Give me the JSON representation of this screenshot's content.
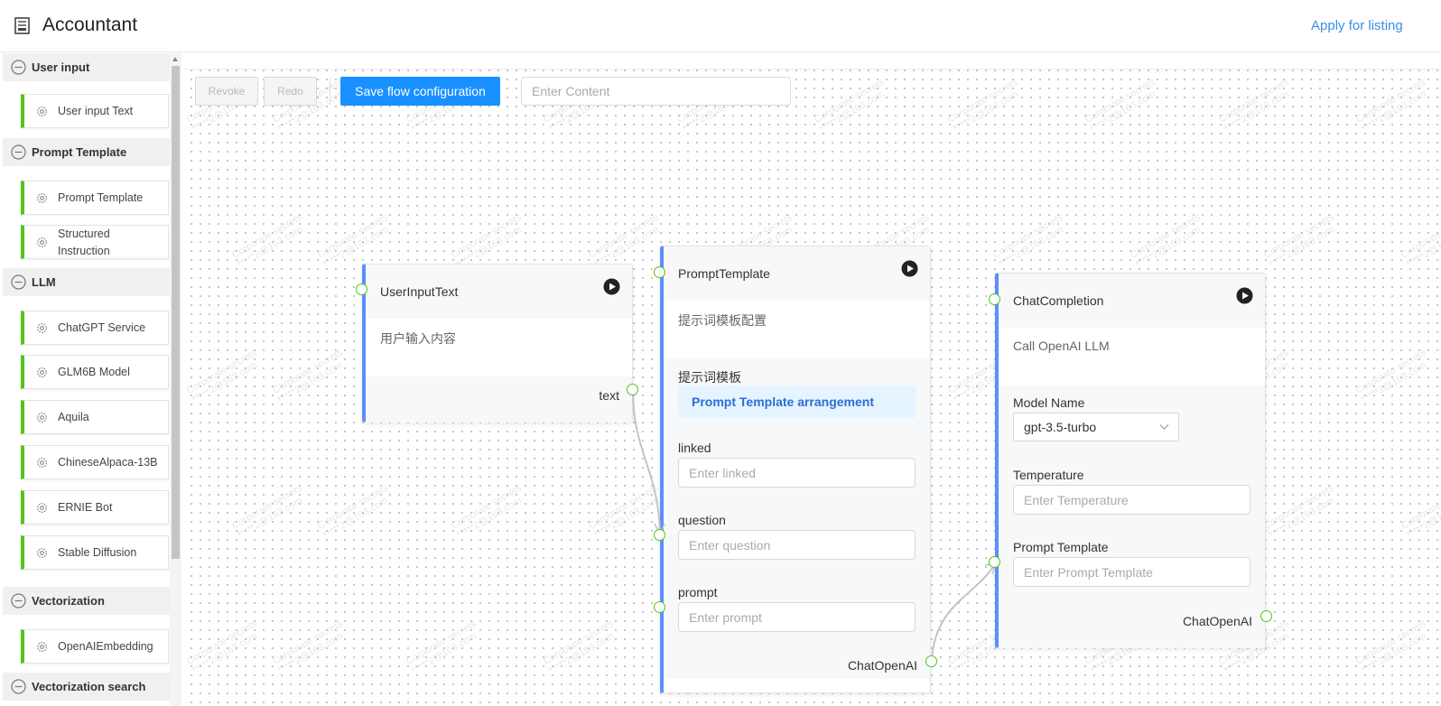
{
  "header": {
    "title": "Accountant",
    "apply_label": "Apply for listing"
  },
  "sidebar": {
    "categories": [
      {
        "label": "User input",
        "items": [
          {
            "label": "User input Text"
          }
        ]
      },
      {
        "label": "Prompt Template",
        "items": [
          {
            "label": "Prompt Template"
          },
          {
            "label": "Structured Instruction"
          }
        ]
      },
      {
        "label": "LLM",
        "items": [
          {
            "label": "ChatGPT Service"
          },
          {
            "label": "GLM6B Model"
          },
          {
            "label": "Aquila"
          },
          {
            "label": "ChineseAlpaca-13B"
          },
          {
            "label": "ERNIE Bot"
          },
          {
            "label": "Stable Diffusion"
          }
        ]
      },
      {
        "label": "Vectorization",
        "items": [
          {
            "label": "OpenAIEmbedding"
          }
        ]
      },
      {
        "label": "Vectorization search",
        "items": []
      }
    ]
  },
  "toolbar": {
    "revoke_label": "Revoke",
    "redo_label": "Redo",
    "save_label": "Save flow configuration",
    "search_placeholder": "Enter Content"
  },
  "watermark": {
    "line1": "Corporate secrets",
    "line2": "*****2@163.com"
  },
  "nodes": {
    "user_input": {
      "title": "UserInputText",
      "description": "用户输入内容",
      "output_label": "text"
    },
    "prompt": {
      "title": "PromptTemplate",
      "description": "提示词模板配置",
      "template_label": "提示词模板",
      "template_button": "Prompt Template arrangement",
      "fields": [
        {
          "label": "linked",
          "placeholder": "Enter linked"
        },
        {
          "label": "question",
          "placeholder": "Enter question"
        },
        {
          "label": "prompt",
          "placeholder": "Enter prompt"
        }
      ],
      "output_label": "ChatOpenAI"
    },
    "chat": {
      "title": "ChatCompletion",
      "description": "Call OpenAI LLM",
      "model_label": "Model Name",
      "model_value": "gpt-3.5-turbo",
      "temperature_label": "Temperature",
      "temperature_placeholder": "Enter Temperature",
      "prompt_label": "Prompt Template",
      "prompt_placeholder": "Enter Prompt Template",
      "output_label": "ChatOpenAI"
    }
  },
  "colors": {
    "accent": "#1890ff",
    "node_border": "#5b8ff9",
    "item_border": "#52c41a",
    "port": "#52c41a"
  }
}
